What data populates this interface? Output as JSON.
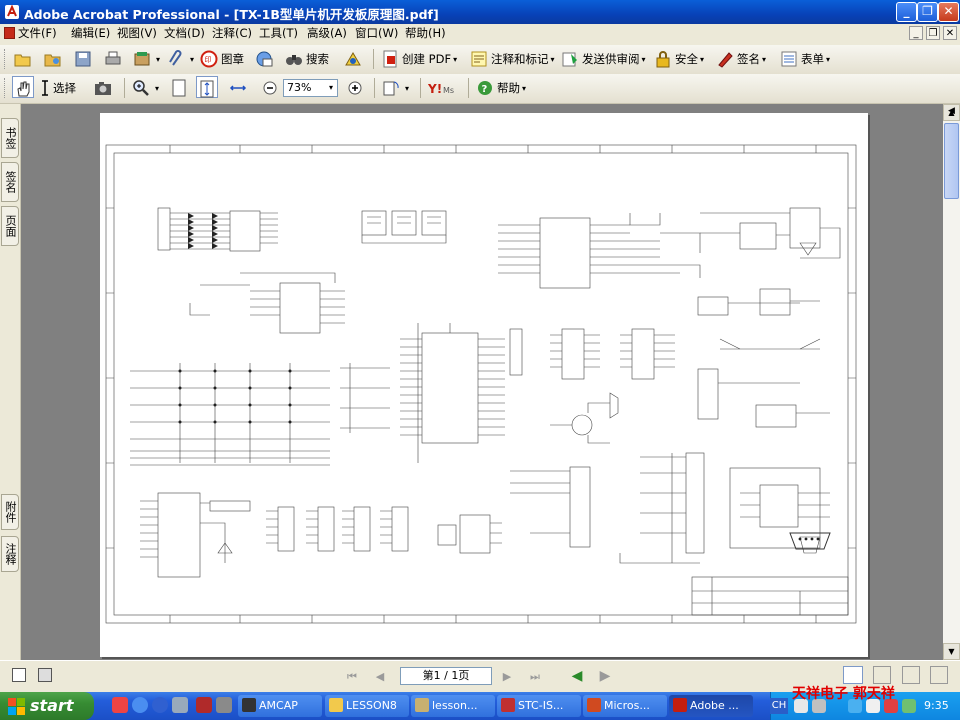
{
  "window": {
    "title": "Adobe Acrobat Professional - [TX-1B型单片机开发板原理图.pdf]"
  },
  "menubar": {
    "items": [
      "文件(F)",
      "编辑(E)",
      "视图(V)",
      "文档(D)",
      "注释(C)",
      "工具(T)",
      "高级(A)",
      "窗口(W)",
      "帮助(H)"
    ]
  },
  "toolbar1": {
    "stamp_label": "图章",
    "search_label": "搜索",
    "create_pdf_label": "创建 PDF",
    "comment_markup_label": "注释和标记",
    "send_review_label": "发送供审阅",
    "security_label": "安全",
    "sign_label": "签名",
    "forms_label": "表单"
  },
  "toolbar2": {
    "select_label": "选择",
    "zoom_value": "73%",
    "help_label": "帮助"
  },
  "side_tabs": {
    "bookmarks": "书签",
    "signatures": "签名",
    "pages": "页面",
    "attachments": "附件",
    "comments": "注释"
  },
  "statusbar": {
    "page_indicator": "第1 / 1页"
  },
  "taskbar": {
    "start_label": "start",
    "tasks": [
      "AMCAP",
      "LESSON8",
      "lesson...",
      "STC-IS...",
      "Micros...",
      "Adobe ..."
    ],
    "lang": "CH",
    "clock": "9:35",
    "watermark": "天祥电子 郭天祥"
  },
  "colors": {
    "titlebar": "#0842b8",
    "taskbar": "#245edb",
    "start": "#378c33",
    "tray": "#0e86e0",
    "page": "#ffffff",
    "workspace": "#808080",
    "watermark": "#e00000"
  }
}
